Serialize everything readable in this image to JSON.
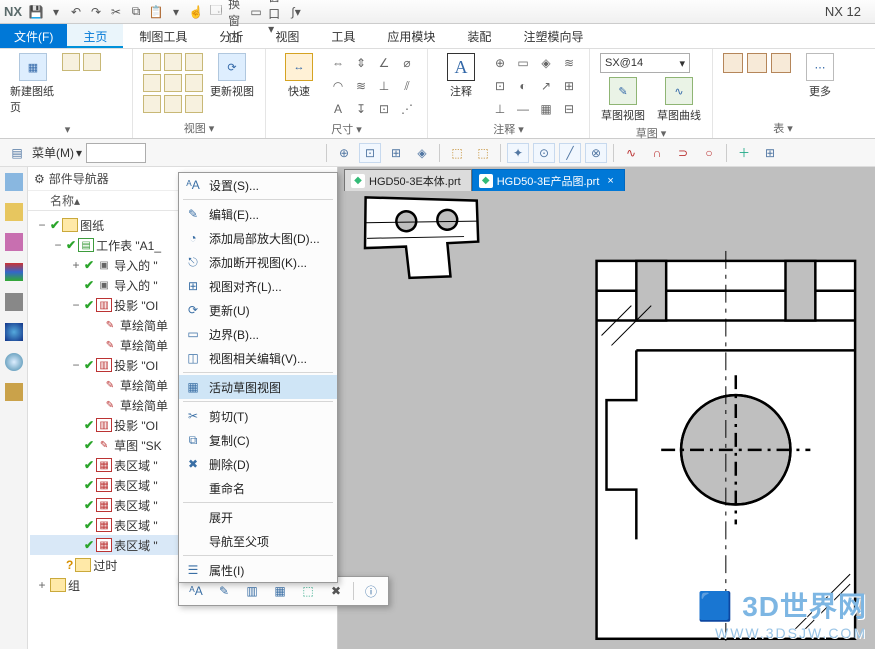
{
  "app": {
    "name": "NX",
    "version": "NX 12"
  },
  "menu": {
    "file": "文件(F)",
    "items": [
      "主页",
      "制图工具",
      "分析",
      "视图",
      "工具",
      "应用模块",
      "装配",
      "注塑模向导"
    ],
    "active_index": 0
  },
  "ribbon": {
    "new_sheet": "新建图纸页",
    "view_group": "视图",
    "update_view": "更新视图",
    "quick": "快速",
    "size_group": "尺寸",
    "annot": "注释",
    "annot_group": "注释",
    "combo_value": "SX@14",
    "sketch_view": "草图视图",
    "sketch_curve": "草图曲线",
    "sketch_group": "草图",
    "more": "更多",
    "table_group": "表"
  },
  "subbar": {
    "menu_label": "菜单(M)"
  },
  "nav": {
    "title": "部件导航器",
    "col": "名称",
    "root": "图纸",
    "sheet": "工作表 \"A1_",
    "imp1": "导入的 \"",
    "imp2": "导入的 \"",
    "proj1": "投影 \"OI",
    "sk1": "草绘简单",
    "sk2": "草绘简单",
    "proj2": "投影 \"OI",
    "sk3": "草绘简单",
    "sk4": "草绘简单",
    "proj3": "投影 \"OI",
    "sk5": "草图 \"SK",
    "reg1": "表区域 \"",
    "reg2": "表区域 \"",
    "reg3": "表区域 \"",
    "reg4": "表区域 \"",
    "reg5": "表区域 \"",
    "outdated": "过时",
    "group": "组"
  },
  "tabs": {
    "t1": "HGD50-3E本体.prt",
    "t2": "HGD50-3E产品图.prt"
  },
  "ctx": {
    "settings": "设置(S)...",
    "edit": "编辑(E)...",
    "addmag": "添加局部放大图(D)...",
    "addbreak": "添加断开视图(K)...",
    "align": "视图对齐(L)...",
    "update": "更新(U)",
    "boundary": "边界(B)...",
    "relview": "视图相关编辑(V)...",
    "activesketch": "活动草图视图",
    "cut": "剪切(T)",
    "copy": "复制(C)",
    "delete": "删除(D)",
    "rename": "重命名",
    "expand": "展开",
    "navparent": "导航至父项",
    "props": "属性(I)"
  },
  "watermark": {
    "line1": "3D世界网",
    "line2": "WWW.3DSJW.COM"
  }
}
